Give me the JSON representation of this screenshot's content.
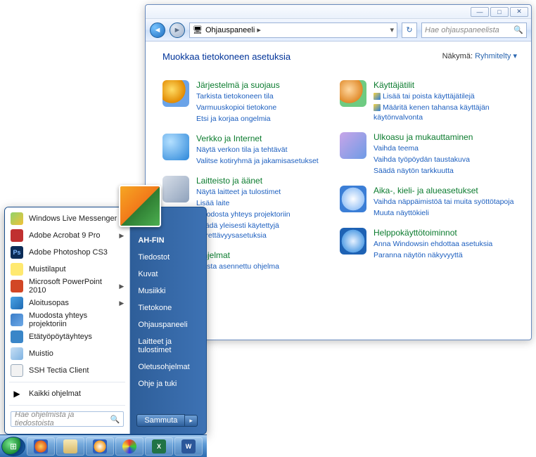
{
  "cp": {
    "path_root": "Ohjauspaneeli",
    "search_placeholder": "Hae ohjauspaneelista",
    "heading": "Muokkaa tietokoneen asetuksia",
    "view_label": "Näkymä:",
    "view_value": "Ryhmitelty",
    "left": [
      {
        "title": "Järjestelmä ja suojaus",
        "links": [
          "Tarkista tietokoneen tila",
          "Varmuuskopioi tietokone",
          "Etsi ja korjaa ongelmia"
        ]
      },
      {
        "title": "Verkko ja Internet",
        "links": [
          "Näytä verkon tila ja tehtävät",
          "Valitse kotiryhmä ja jakamisasetukset"
        ]
      },
      {
        "title": "Laitteisto ja äänet",
        "links": [
          "Näytä laitteet ja tulostimet",
          "Lisää laite",
          "Muodosta yhteys projektoriin",
          "Säädä yleisesti käytettyjä siirrettävyysasetuksia"
        ]
      },
      {
        "title": "Ohjelmat",
        "links": [
          "Poista asennettu ohjelma"
        ]
      }
    ],
    "right": [
      {
        "title": "Käyttäjätilit",
        "links": [
          "Lisää tai poista käyttäjätilejä",
          "Määritä kenen tahansa käyttäjän käytönvalvonta"
        ],
        "shield": true
      },
      {
        "title": "Ulkoasu ja mukauttaminen",
        "links": [
          "Vaihda teema",
          "Vaihda työpöydän taustakuva",
          "Säädä näytön tarkkuutta"
        ]
      },
      {
        "title": "Aika-, kieli- ja alueasetukset",
        "links": [
          "Vaihda näppäimistöä tai muita syöttötapoja",
          "Muuta näyttökieli"
        ]
      },
      {
        "title": "Helppokäyttötoiminnot",
        "links": [
          "Anna Windowsin ehdottaa asetuksia",
          "Paranna näytön näkyvyyttä"
        ]
      }
    ]
  },
  "start": {
    "user": "AH-FIN",
    "left": [
      {
        "icon": "ic-wlm",
        "label": "Windows Live Messenger",
        "sub": false
      },
      {
        "icon": "ic-acro",
        "label": "Adobe Acrobat 9 Pro",
        "sub": true
      },
      {
        "icon": "ic-ps",
        "label": "Adobe Photoshop CS3",
        "sub": false
      },
      {
        "icon": "ic-sticky",
        "label": "Muistilaput",
        "sub": false
      },
      {
        "icon": "ic-ppt",
        "label": "Microsoft PowerPoint 2010",
        "sub": true
      },
      {
        "icon": "ic-start",
        "label": "Aloitusopas",
        "sub": true
      },
      {
        "icon": "ic-proj",
        "label": "Muodosta yhteys projektoriin",
        "sub": false
      },
      {
        "icon": "ic-rdp",
        "label": "Etätyöpöytäyhteys",
        "sub": false
      },
      {
        "icon": "ic-note",
        "label": "Muistio",
        "sub": false
      },
      {
        "icon": "ic-ssh",
        "label": "SSH Tectia Client",
        "sub": false
      }
    ],
    "all_programs": "Kaikki ohjelmat",
    "search_placeholder": "Hae ohjelmista ja tiedostoista",
    "right": [
      "Tiedostot",
      "Kuvat",
      "Musiikki",
      "Tietokone",
      "Ohjauspaneeli",
      "Laitteet ja tulostimet",
      "Oletusohjelmat",
      "Ohje ja tuki"
    ],
    "shutdown": "Sammuta"
  }
}
